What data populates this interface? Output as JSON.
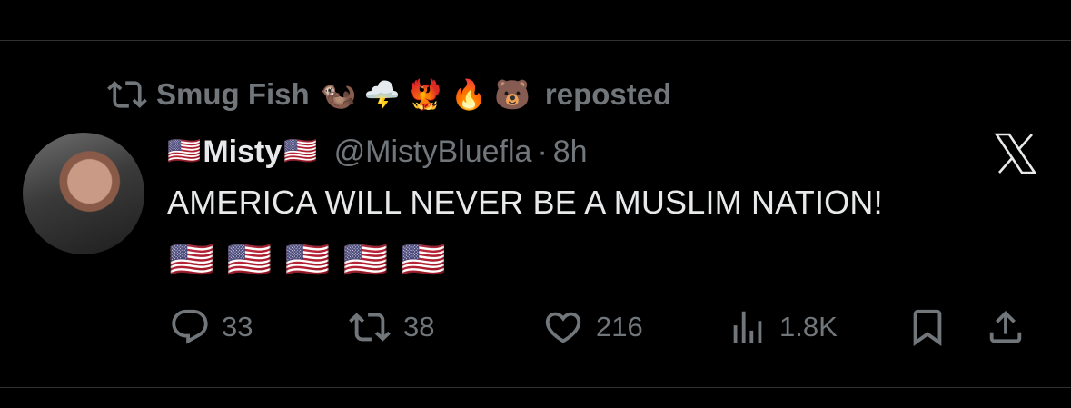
{
  "repost": {
    "user": "Smug Fish",
    "emojis": [
      "🦦",
      "🌩️",
      "🐦‍🔥",
      "🔥",
      "🐻"
    ],
    "label": "reposted"
  },
  "author": {
    "flag_left": "🇺🇸",
    "name": "Misty",
    "flag_right": "🇺🇸",
    "handle": "@MistyBluefla",
    "separator": "·",
    "time": "8h"
  },
  "tweet": {
    "text": "AMERICA WILL NEVER BE A MUSLIM NATION!",
    "flags": [
      "🇺🇸",
      "🇺🇸",
      "🇺🇸",
      "🇺🇸",
      "🇺🇸"
    ]
  },
  "actions": {
    "replies": "33",
    "reposts": "38",
    "likes": "216",
    "views": "1.8K"
  },
  "colors": {
    "background": "#000000",
    "text": "#e7e9ea",
    "muted": "#71767b",
    "divider": "#2f3336"
  }
}
